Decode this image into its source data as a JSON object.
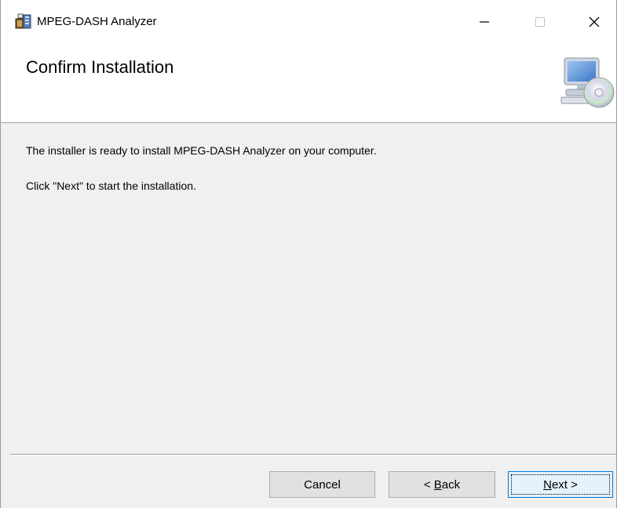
{
  "window": {
    "title": "MPEG-DASH Analyzer",
    "app_icon": "installer-package-icon",
    "controls": {
      "minimize_icon": "minimize-icon",
      "maximize_icon": "maximize-icon",
      "close_icon": "close-icon"
    }
  },
  "banner": {
    "title": "Confirm Installation",
    "icon": "computer-with-disc-icon"
  },
  "content": {
    "line1": "The installer is ready to install MPEG-DASH Analyzer on your computer.",
    "line2": "Click \"Next\" to start the installation."
  },
  "buttons": {
    "cancel": "Cancel",
    "back_prefix": "< ",
    "back_mnemonic": "B",
    "back_rest": "ack",
    "next_mnemonic": "N",
    "next_rest": "ext >"
  },
  "colors": {
    "accent": "#0078d7",
    "window_bg": "#f0f0f0",
    "banner_bg": "#ffffff"
  }
}
